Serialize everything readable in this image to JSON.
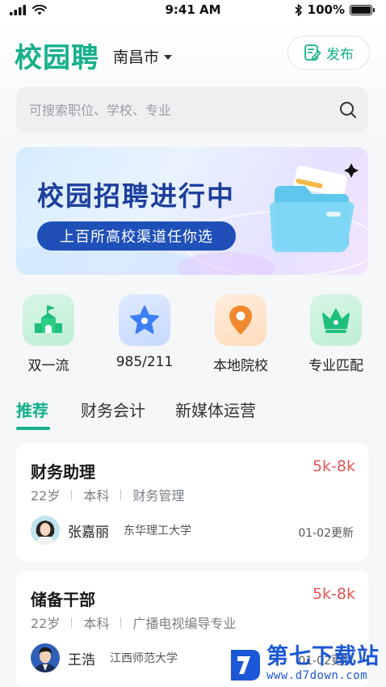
{
  "status_bar": {
    "time": "9:41 AM",
    "battery": "100%"
  },
  "header": {
    "logo": "校园聘",
    "city": "南昌市",
    "publish_label": "发布"
  },
  "search": {
    "placeholder": "可搜索职位、学校、专业"
  },
  "banner": {
    "title": "校园招聘进行中",
    "subtitle": "上百所高校渠道任你选"
  },
  "quick_nav": [
    {
      "label": "双一流",
      "icon": "school-building-icon",
      "color": "#1fbf7a"
    },
    {
      "label": "985/211",
      "icon": "star-icon",
      "color": "#3d7ef5"
    },
    {
      "label": "本地院校",
      "icon": "location-pin-icon",
      "color": "#f0892e"
    },
    {
      "label": "专业匹配",
      "icon": "crown-icon",
      "color": "#1fbf7a"
    }
  ],
  "tabs": [
    {
      "label": "推荐",
      "active": true
    },
    {
      "label": "财务会计",
      "active": false
    },
    {
      "label": "新媒体运营",
      "active": false
    }
  ],
  "jobs": [
    {
      "title": "财务助理",
      "salary": "5k-8k",
      "tags": [
        "22岁",
        "本科",
        "财务管理"
      ],
      "poster_name": "张嘉丽",
      "school": "东华理工大学",
      "date": "01-02更新"
    },
    {
      "title": "储备干部",
      "salary": "5k-8k",
      "tags": [
        "22岁",
        "本科",
        "广播电视编导专业"
      ],
      "poster_name": "王浩",
      "school": "江西师范大学",
      "date": "01-02更新"
    }
  ],
  "watermark": {
    "name": "第七下载站",
    "url": "www.d7down.com"
  },
  "colors": {
    "brand": "#14b08a",
    "salary": "#e15656",
    "banner_pill": "#1f4fb8"
  }
}
